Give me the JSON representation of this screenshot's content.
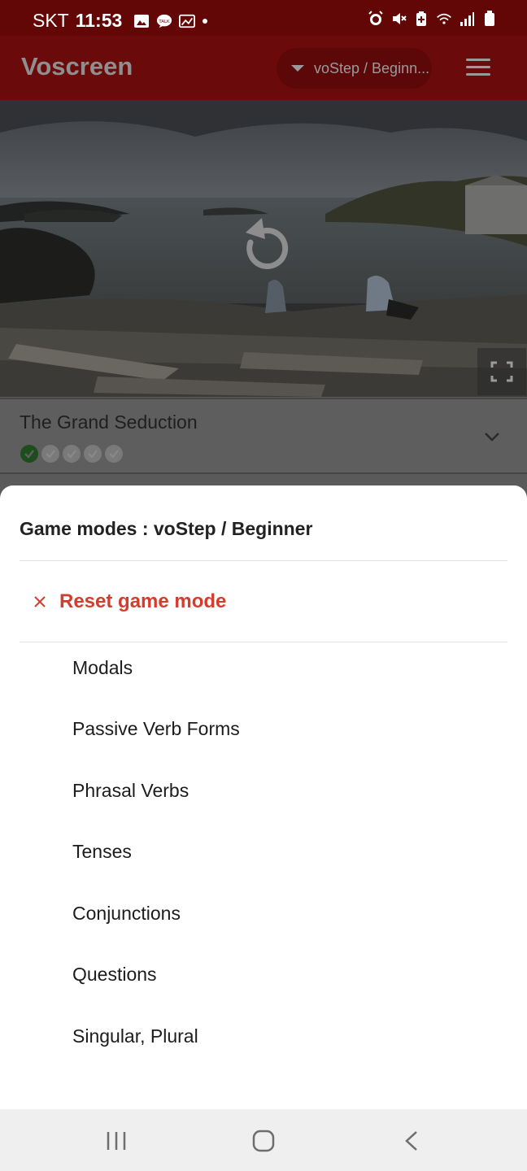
{
  "status_bar": {
    "carrier": "SKT",
    "time": "11:53",
    "left_icons": [
      "gallery-icon",
      "talk-icon",
      "image-icon",
      "dot-icon"
    ],
    "right_icons": [
      "alarm-icon",
      "mute-icon",
      "battery-saver-icon",
      "wifi-icon",
      "signal-icon",
      "battery-icon"
    ]
  },
  "app_bar": {
    "title": "Voscreen",
    "mode_selector": "voStep / Beginn...",
    "menu_icon": "hamburger-icon"
  },
  "video": {
    "replay_icon": "replay-icon",
    "fullscreen_icon": "fullscreen-icon"
  },
  "video_info": {
    "title": "The Grand Seduction",
    "progress_total": 5,
    "progress_completed": 1,
    "expand_icon": "chevron-down-icon"
  },
  "sheet": {
    "title": "Game modes : voStep / Beginner",
    "reset_label": "Reset game mode",
    "items": [
      {
        "label": "Modals"
      },
      {
        "label": "Passive Verb Forms"
      },
      {
        "label": "Phrasal Verbs"
      },
      {
        "label": "Tenses"
      },
      {
        "label": "Conjunctions"
      },
      {
        "label": "Questions"
      },
      {
        "label": "Singular, Plural"
      }
    ]
  },
  "colors": {
    "accent_red": "#d43d2e",
    "app_bar": "#6b0a0a",
    "check_green": "#1d4d1c"
  },
  "nav_bar": {
    "icons": [
      "recent-apps-icon",
      "home-icon",
      "back-icon"
    ]
  }
}
